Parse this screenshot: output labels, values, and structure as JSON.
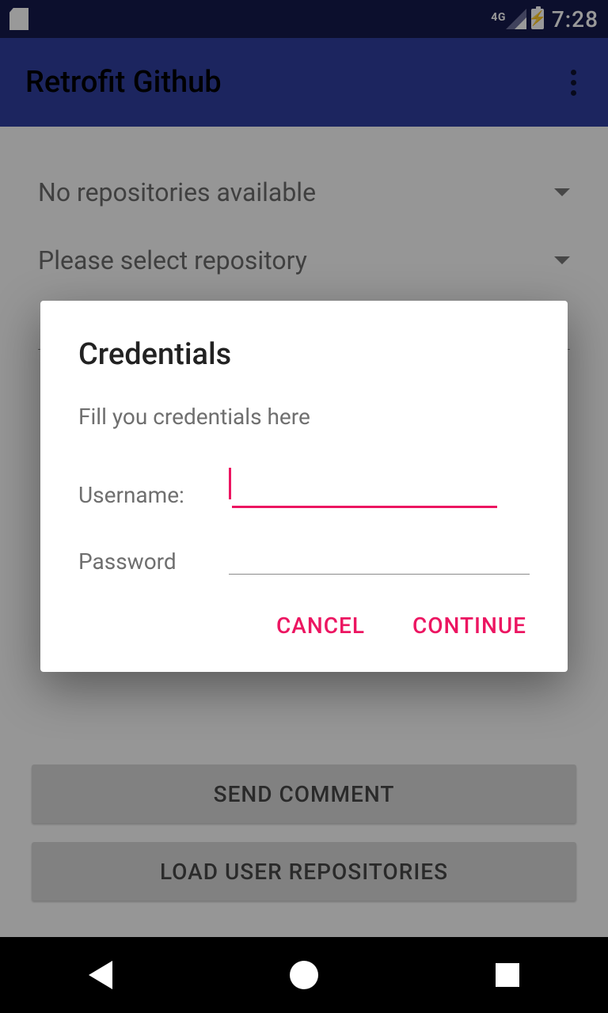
{
  "status": {
    "network": "4G",
    "time": "7:28"
  },
  "appbar": {
    "title": "Retrofit Github"
  },
  "main": {
    "spinner1": "No repositories available",
    "spinner2": "Please select repository",
    "send_button": "SEND COMMENT",
    "load_button": "LOAD USER REPOSITORIES"
  },
  "dialog": {
    "title": "Credentials",
    "subtitle": "Fill you credentials here",
    "username_label": "Username:",
    "password_label": "Password",
    "cancel": "CANCEL",
    "continue": "CONTINUE"
  }
}
